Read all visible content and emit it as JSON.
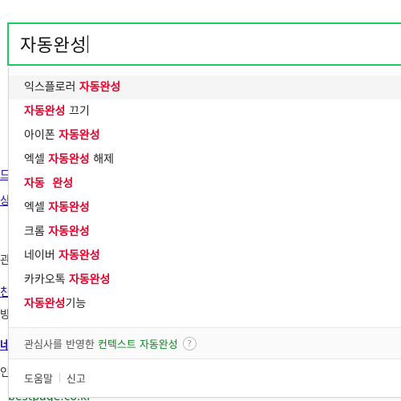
{
  "search": {
    "query": "자동완성"
  },
  "suggestions": [
    {
      "parts": [
        {
          "t": "익스플로러 ",
          "h": false
        },
        {
          "t": "자동완성",
          "h": true
        }
      ]
    },
    {
      "parts": [
        {
          "t": "자동완성",
          "h": true
        },
        {
          "t": " 끄기",
          "h": false
        }
      ]
    },
    {
      "parts": [
        {
          "t": "아이폰 ",
          "h": false
        },
        {
          "t": "자동완성",
          "h": true
        }
      ]
    },
    {
      "parts": [
        {
          "t": "엑셀 ",
          "h": false
        },
        {
          "t": "자동완성",
          "h": true
        },
        {
          "t": " 해제",
          "h": false
        }
      ]
    },
    {
      "parts": [
        {
          "t": "자동  완성",
          "h": true
        }
      ]
    },
    {
      "parts": [
        {
          "t": "엑셀 ",
          "h": false
        },
        {
          "t": "자동완성",
          "h": true
        }
      ]
    },
    {
      "parts": [
        {
          "t": "크롬 ",
          "h": false
        },
        {
          "t": "자동완성",
          "h": true
        }
      ]
    },
    {
      "parts": [
        {
          "t": "네이버 ",
          "h": false
        },
        {
          "t": "자동완성",
          "h": true
        }
      ]
    },
    {
      "parts": [
        {
          "t": "카카오톡 ",
          "h": false
        },
        {
          "t": "자동완성",
          "h": true
        }
      ]
    },
    {
      "parts": [
        {
          "t": "자동완성",
          "h": true
        },
        {
          "t": "기능",
          "h": false
        }
      ]
    }
  ],
  "context": {
    "prefix": "관심사를 반영한",
    "link": "컨텍스트 자동완성",
    "help_icon_glyph": "?"
  },
  "footer": {
    "help": "도움말",
    "report": "신고"
  },
  "background": {
    "frag1": "드",
    "frag2": "상",
    "frag3": "관",
    "frag4": "친",
    "frag5": "방",
    "frag6": "네",
    "frag7": "인",
    "url": "bestpage.co.kr"
  },
  "colors": {
    "search_border": "#19ce60",
    "highlight": "#e5002a",
    "context_link": "#0a8a1e"
  }
}
